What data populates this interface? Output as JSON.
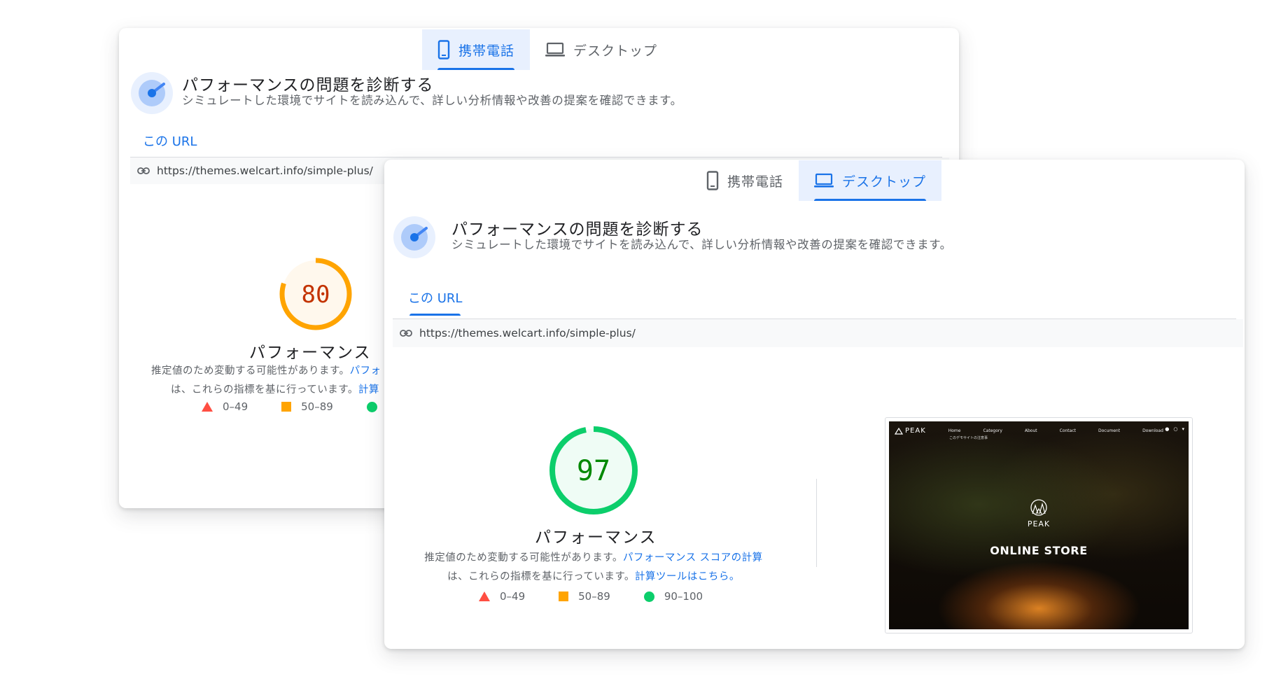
{
  "colors": {
    "accent": "#1a73e8",
    "tab_active_bg": "#e8f0fe",
    "fail": "#ff4e42",
    "average": "#ffa400",
    "pass": "#0cce6b",
    "average_text": "#c33300",
    "pass_text": "#008800"
  },
  "back_panel": {
    "tabs": [
      {
        "label": "携帯電話",
        "icon": "mobile-phone-icon",
        "active": true
      },
      {
        "label": "デスクトップ",
        "icon": "laptop-icon",
        "active": false
      }
    ],
    "diagnose": {
      "title": "パフォーマンスの問題を診断する",
      "description": "シミュレートした環境でサイトを読み込んで、詳しい分析情報や改善の提案を確認できます。"
    },
    "url_tab_label": "この URL",
    "url": "https://themes.welcart.info/simple-plus/",
    "score": 80,
    "score_label": "パフォーマンス",
    "explain_line1": "推定値のため変動する可能性があります。",
    "explain_link1": "パフォ",
    "explain_line2": "は、これらの指標を基に行っています。",
    "explain_link2": "計算",
    "legend": [
      "0–49",
      "50–89"
    ]
  },
  "front_panel": {
    "tabs": [
      {
        "label": "携帯電話",
        "icon": "mobile-phone-icon",
        "active": false
      },
      {
        "label": "デスクトップ",
        "icon": "laptop-icon",
        "active": true
      }
    ],
    "diagnose": {
      "title": "パフォーマンスの問題を診断する",
      "description": "シミュレートした環境でサイトを読み込んで、詳しい分析情報や改善の提案を確認できます。"
    },
    "url_tab_label": "この URL",
    "url": "https://themes.welcart.info/simple-plus/",
    "score": 97,
    "score_label": "パフォーマンス",
    "explain_line1": "推定値のため変動する可能性があります。",
    "explain_link1": "パフォーマンス スコアの計算",
    "explain_line2": "は、これらの指標を基に行っています。",
    "explain_link2": "計算ツールはこちら。",
    "legend": [
      "0–49",
      "50–89",
      "90–100"
    ],
    "screenshot": {
      "brand": "PEAK",
      "nav": [
        "Home",
        "Category",
        "About",
        "Contact",
        "Document",
        "Download"
      ],
      "tagline": "このデモサイトの注意事",
      "logo_text": "PEAK",
      "headline": "ONLINE STORE"
    }
  }
}
